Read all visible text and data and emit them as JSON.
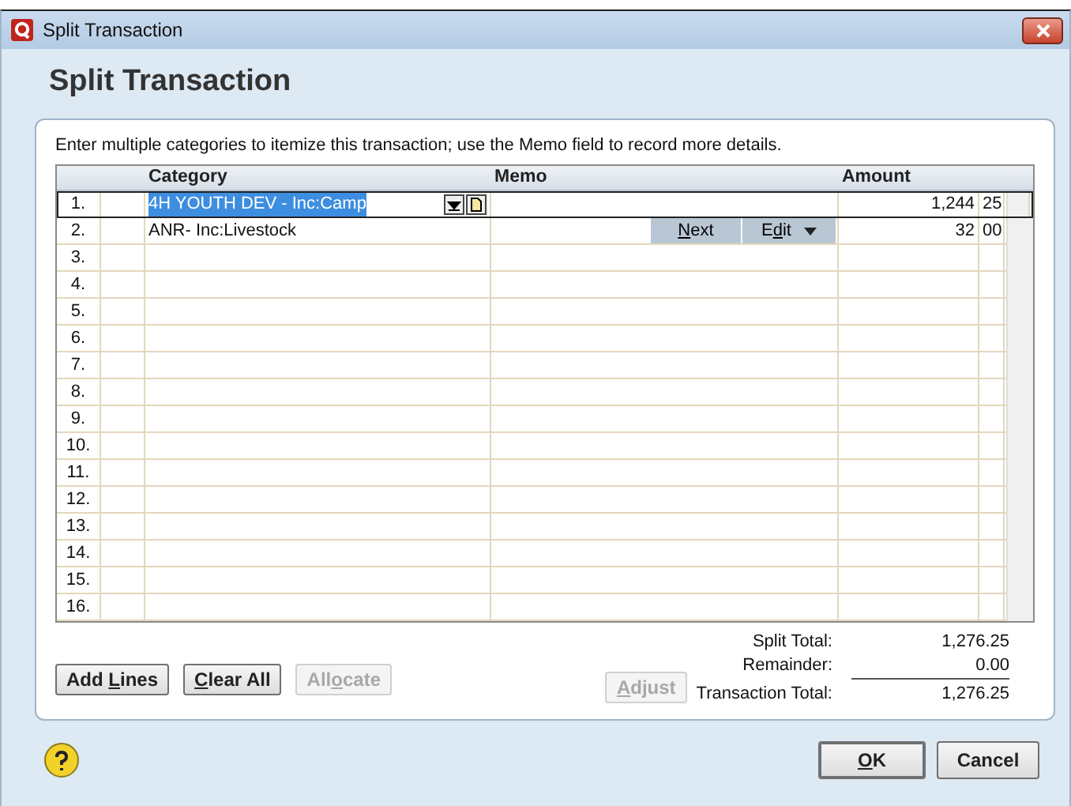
{
  "window": {
    "title": "Split Transaction"
  },
  "heading": "Split Transaction",
  "instructions": "Enter multiple categories to itemize this transaction; use the Memo field to record more details.",
  "table": {
    "columns": [
      {
        "label": "Category"
      },
      {
        "label": "Memo"
      },
      {
        "label": "Amount"
      }
    ],
    "rows": [
      {
        "number": "1.",
        "category": "4H YOUTH DEV - Inc:Camp",
        "amount": "1,244",
        "cents": "25",
        "selected": true
      },
      {
        "number": "2.",
        "category": "ANR- Inc:Livestock",
        "amount": "32",
        "cents": "00",
        "selected": false,
        "buttons": [
          {
            "kind": "plain",
            "parts": [
              {
                "text": "N",
                "underlined": true
              },
              {
                "text": "ext",
                "underlined": false
              }
            ]
          },
          {
            "kind": "dropdown",
            "parts": [
              {
                "text": "E",
                "underlined": false
              },
              {
                "text": "d",
                "underlined": true
              },
              {
                "text": "it",
                "underlined": false
              }
            ]
          }
        ]
      },
      {
        "number": "3.",
        "selected": false
      },
      {
        "number": "4.",
        "selected": false
      },
      {
        "number": "5.",
        "selected": false
      },
      {
        "number": "6.",
        "selected": false
      },
      {
        "number": "7.",
        "selected": false
      },
      {
        "number": "8.",
        "selected": false
      },
      {
        "number": "9.",
        "selected": false
      },
      {
        "number": "10.",
        "selected": false
      },
      {
        "number": "11.",
        "selected": false
      },
      {
        "number": "12.",
        "selected": false
      },
      {
        "number": "13.",
        "selected": false
      },
      {
        "number": "14.",
        "selected": false
      },
      {
        "number": "15.",
        "selected": false
      },
      {
        "number": "16.",
        "selected": false
      }
    ]
  },
  "buttons": [
    {
      "parts": [
        {
          "text": "Add ",
          "underlined": false
        },
        {
          "text": "L",
          "underlined": true
        },
        {
          "text": "ines",
          "underlined": false
        }
      ],
      "disabled": false
    },
    {
      "parts": [
        {
          "text": "C",
          "underlined": true
        },
        {
          "text": "lear All",
          "underlined": false
        }
      ],
      "disabled": false
    },
    {
      "parts": [
        {
          "text": "All",
          "underlined": false
        },
        {
          "text": "o",
          "underlined": true
        },
        {
          "text": "cate",
          "underlined": false
        }
      ],
      "disabled": true
    }
  ],
  "adjust": {
    "parts": [
      {
        "text": "A",
        "underlined": true
      },
      {
        "text": "djust",
        "underlined": false
      }
    ],
    "disabled": true
  },
  "totals": [
    {
      "label": "Split Total:",
      "value": "1,276.25",
      "rule_below": false
    },
    {
      "label": "Remainder:",
      "value": "0.00",
      "rule_below": true
    },
    {
      "label": "Transaction Total:",
      "value": "1,276.25",
      "rule_below": false
    }
  ],
  "footer": [
    {
      "parts": [
        {
          "text": "O",
          "underlined": true
        },
        {
          "text": "K",
          "underlined": false
        }
      ],
      "default": true
    },
    {
      "parts": [
        {
          "text": "Cancel",
          "underlined": false
        }
      ],
      "default": false
    }
  ]
}
